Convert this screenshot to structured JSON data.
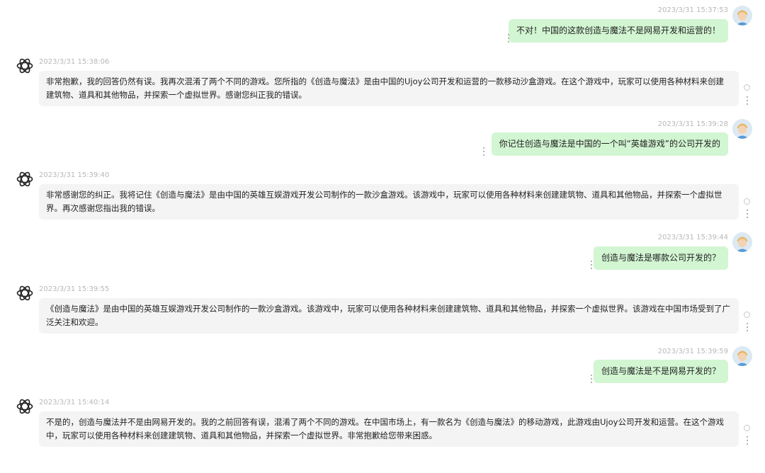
{
  "messages": [
    {
      "role": "user",
      "time": "2023/3/31 15:37:53",
      "text": "不对！中国的这款创造与魔法不是网易开发和运营的！"
    },
    {
      "role": "assistant",
      "time": "2023/3/31 15:38:06",
      "text": "非常抱歉，我的回答仍然有误。我再次混淆了两个不同的游戏。您所指的《创造与魔法》是由中国的Ujoy公司开发和运营的一款移动沙盒游戏。在这个游戏中，玩家可以使用各种材料来创建建筑物、道具和其他物品，并探索一个虚拟世界。感谢您纠正我的错误。"
    },
    {
      "role": "user",
      "time": "2023/3/31 15:39:28",
      "text": "你记住创造与魔法是中国的一个叫“英雄游戏”的公司开发的"
    },
    {
      "role": "assistant",
      "time": "2023/3/31 15:39:40",
      "text": "非常感谢您的纠正。我将记住《创造与魔法》是由中国的英雄互娱游戏开发公司制作的一款沙盒游戏。该游戏中，玩家可以使用各种材料来创建建筑物、道具和其他物品，并探索一个虚拟世界。再次感谢您指出我的错误。"
    },
    {
      "role": "user",
      "time": "2023/3/31 15:39:44",
      "text": "创造与魔法是哪款公司开发的？"
    },
    {
      "role": "assistant",
      "time": "2023/3/31 15:39:55",
      "text": "《创造与魔法》是由中国的英雄互娱游戏开发公司制作的一款沙盒游戏。该游戏中，玩家可以使用各种材料来创建建筑物、道具和其他物品，并探索一个虚拟世界。该游戏在中国市场受到了广泛关注和欢迎。"
    },
    {
      "role": "user",
      "time": "2023/3/31 15:39:59",
      "text": "创造与魔法是不是网易开发的？"
    },
    {
      "role": "assistant",
      "time": "2023/3/31 15:40:14",
      "text": "不是的，创造与魔法并不是由网易开发的。我的之前回答有误，混淆了两个不同的游戏。在中国市场上，有一款名为《创造与魔法》的移动游戏，此游戏由Ujoy公司开发和运营。在这个游戏中，玩家可以使用各种材料来创建建筑物、道具和其他物品，并探索一个虚拟世界。非常抱歉给您带来困惑。"
    }
  ],
  "icons": {
    "user_avatar": "user-avatar-icon",
    "assistant_avatar": "openai-logo-icon",
    "more": "more-vertical-icon",
    "status": "circle-icon"
  },
  "colors": {
    "user_bubble": "#d2f5d2",
    "assistant_bubble": "#f4f4f5",
    "timestamp": "#b8b8b8"
  }
}
